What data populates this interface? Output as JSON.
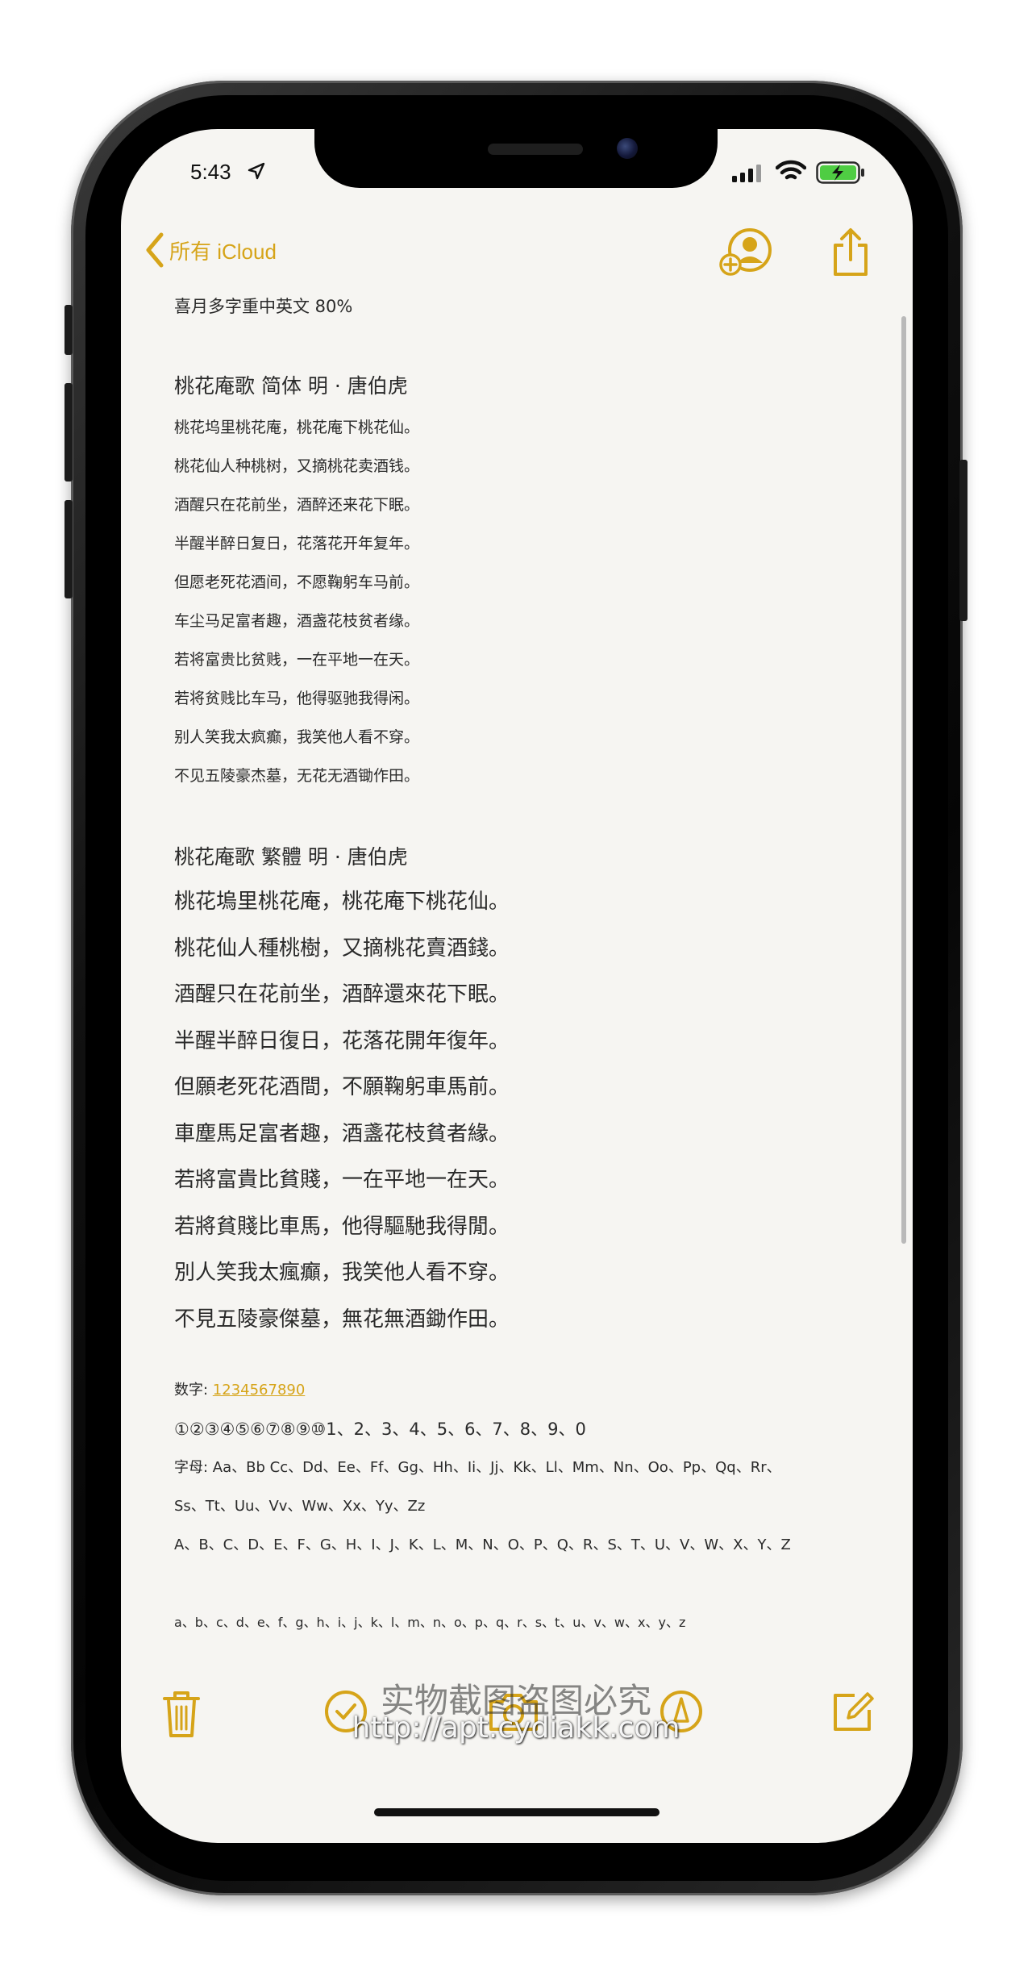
{
  "status_bar": {
    "time": "5:43"
  },
  "nav": {
    "back_label": "所有 iCloud"
  },
  "note": {
    "header": "喜月多字重中英文 80%",
    "simplified": {
      "title": "桃花庵歌  简体   明 · 唐伯虎",
      "lines": [
        "桃花坞里桃花庵，桃花庵下桃花仙。",
        "桃花仙人种桃树，又摘桃花卖酒钱。",
        "酒醒只在花前坐，酒醉还来花下眠。",
        "半醒半醉日复日，花落花开年复年。",
        "但愿老死花酒间，不愿鞠躬车马前。",
        "车尘马足富者趣，酒盏花枝贫者缘。",
        "若将富贵比贫贱，一在平地一在天。",
        "若将贫贱比车马，他得驱驰我得闲。",
        "别人笑我太疯癫，我笑他人看不穿。",
        "不见五陵豪杰墓，无花无酒锄作田。"
      ]
    },
    "traditional": {
      "title": "桃花庵歌  繁體      明 · 唐伯虎",
      "lines": [
        "桃花塢里桃花庵，桃花庵下桃花仙。",
        "桃花仙人種桃樹，又摘桃花賣酒錢。",
        "酒醒只在花前坐，酒醉還來花下眠。",
        "半醒半醉日復日，花落花開年復年。",
        "但願老死花酒間，不願鞠躬車馬前。",
        "車塵馬足富者趣，酒盞花枝貧者緣。",
        "若將富貴比貧賤，一在平地一在天。",
        "若將貧賤比車馬，他得驅馳我得閒。",
        "別人笑我太瘋癲，我笑他人看不穿。",
        "不見五陵豪傑墓，無花無酒鋤作田。"
      ]
    },
    "numbers_label": "数字: ",
    "numbers_link": "1234567890",
    "numbers_line": "①②③④⑤⑥⑦⑧⑨⑩1、2、3、4、5、6、7、8、9、0",
    "letters_line1": "字母: Aa、Bb Cc、Dd、Ee、Ff、Gg、Hh、Ii、Jj、Kk、Ll、Mm、Nn、Oo、Pp、Qq、Rr、",
    "letters_line2": "Ss、Tt、Uu、Vv、Ww、Xx、Yy、Zz",
    "upper_line": "A、B、C、D、E、F、G、H、I、J、K、L、M、N、O、P、Q、R、S、T、U、V、W、X、Y、Z",
    "lower_line": "a、b、c、d、e、f、g、h、i、j、k、l、m、n、o、p、q、r、s、t、u、v、w、x、y、z"
  },
  "watermark": {
    "text": "实物截图盗图必究",
    "url": "http://apt.cydiakk.com"
  },
  "colors": {
    "accent": "#d6a419",
    "paper": "#f6f5f2",
    "text": "#2a2a2a"
  },
  "icons": [
    "location-arrow-icon",
    "signal-icon",
    "wifi-icon",
    "battery-charging-icon",
    "chevron-left-icon",
    "add-person-icon",
    "share-icon",
    "trash-icon",
    "checklist-icon",
    "camera-icon",
    "markup-icon",
    "compose-icon"
  ]
}
